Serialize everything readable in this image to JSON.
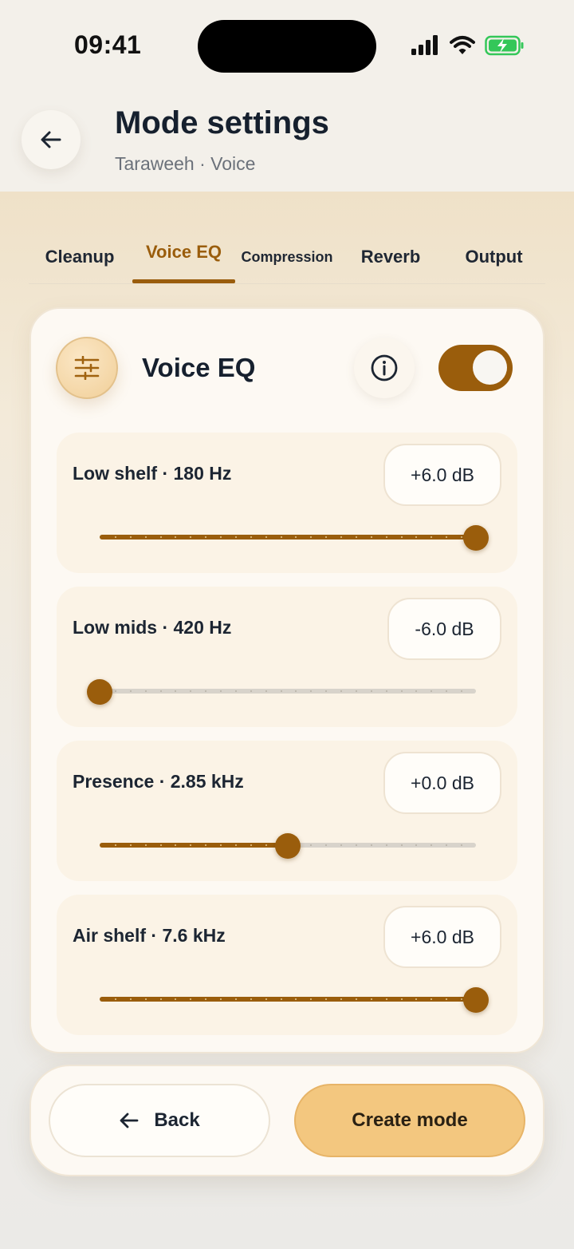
{
  "status_bar": {
    "time": "09:41"
  },
  "header": {
    "title": "Mode settings",
    "subtitle": "Taraweeh · Voice"
  },
  "tabs": [
    {
      "label": "Cleanup",
      "active": false
    },
    {
      "label": "Voice EQ",
      "active": true
    },
    {
      "label": "Compression",
      "active": false
    },
    {
      "label": "Reverb",
      "active": false
    },
    {
      "label": "Output",
      "active": false
    }
  ],
  "section": {
    "title": "Voice EQ",
    "enabled": true,
    "icon": "sliders-icon",
    "info_icon": "info-icon"
  },
  "bands": [
    {
      "label": "Low shelf · 180 Hz",
      "value": "+6.0 dB",
      "level": 1.0
    },
    {
      "label": "Low mids · 420 Hz",
      "value": "-6.0 dB",
      "level": 0.0
    },
    {
      "label": "Presence · 2.85 kHz",
      "value": "+0.0 dB",
      "level": 0.5
    },
    {
      "label": "Air shelf · 7.6 kHz",
      "value": "+6.0 dB",
      "level": 1.0
    }
  ],
  "footer": {
    "back_label": "Back",
    "create_label": "Create mode"
  },
  "colors": {
    "accent": "#9a5d0c",
    "primary_button": "#f3c77f",
    "battery": "#34c759"
  }
}
